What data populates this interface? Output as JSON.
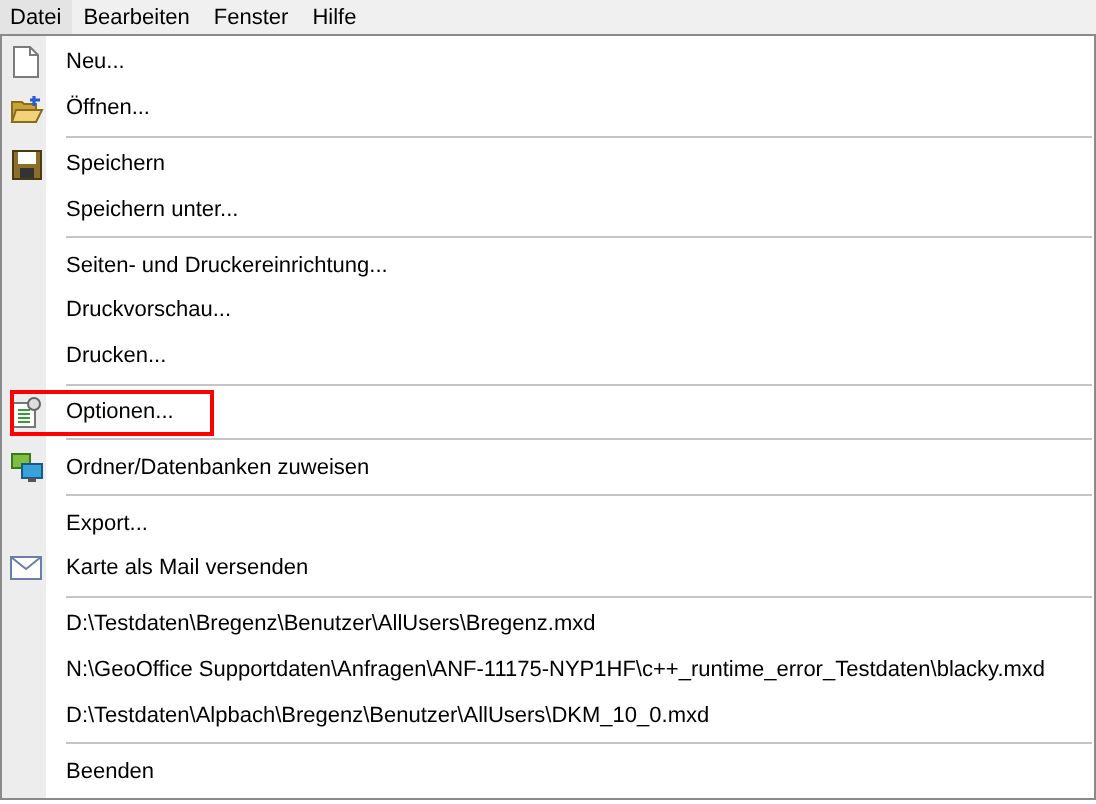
{
  "menubar": [
    {
      "label": "Datei",
      "selected": true
    },
    {
      "label": "Bearbeiten",
      "selected": false
    },
    {
      "label": "Fenster",
      "selected": false
    },
    {
      "label": "Hilfe",
      "selected": false
    }
  ],
  "menu": {
    "items": [
      {
        "kind": "item",
        "label": "Neu..."
      },
      {
        "kind": "item",
        "label": "Öffnen..."
      },
      {
        "kind": "separator"
      },
      {
        "kind": "item",
        "label": "Speichern"
      },
      {
        "kind": "item",
        "label": "Speichern unter..."
      },
      {
        "kind": "separator"
      },
      {
        "kind": "item",
        "label": "Seiten- und Druckereinrichtung..."
      },
      {
        "kind": "item",
        "label": "Druckvorschau..."
      },
      {
        "kind": "item",
        "label": "Drucken..."
      },
      {
        "kind": "separator"
      },
      {
        "kind": "item",
        "label": "Optionen...",
        "highlighted": true
      },
      {
        "kind": "separator"
      },
      {
        "kind": "item",
        "label": "Ordner/Datenbanken zuweisen"
      },
      {
        "kind": "separator"
      },
      {
        "kind": "item",
        "label": "Export..."
      },
      {
        "kind": "item",
        "label": "Karte als Mail versenden"
      },
      {
        "kind": "separator"
      },
      {
        "kind": "item",
        "label": "D:\\Testdaten\\Bregenz\\Benutzer\\AllUsers\\Bregenz.mxd"
      },
      {
        "kind": "item",
        "label": "N:\\GeoOffice Supportdaten\\Anfragen\\ANF-11175-NYP1HF\\c++_runtime_error_Testdaten\\blacky.mxd"
      },
      {
        "kind": "item",
        "label": "D:\\Testdaten\\Alpbach\\Bregenz\\Benutzer\\AllUsers\\DKM_10_0.mxd"
      },
      {
        "kind": "separator"
      },
      {
        "kind": "item",
        "label": "Beenden"
      }
    ]
  }
}
